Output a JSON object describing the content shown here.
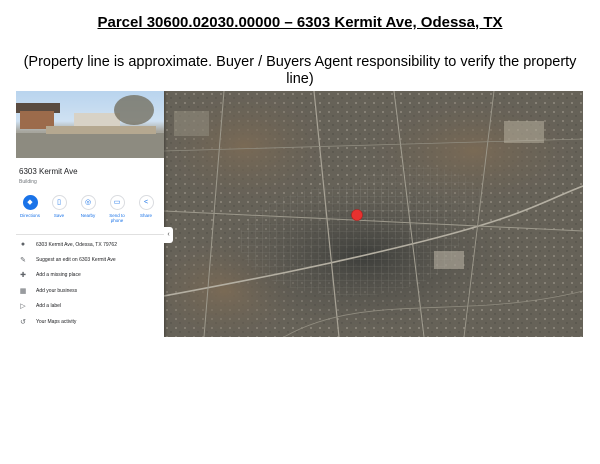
{
  "header": {
    "title": "Parcel 30600.02030.00000 – 6303 Kermit Ave, Odessa, TX",
    "note": "(Property line is approximate.  Buyer / Buyers Agent responsibility to verify the property line)"
  },
  "place": {
    "name": "6303 Kermit Ave",
    "type": "Building"
  },
  "actions": [
    {
      "label": "Directions",
      "icon": "directions-icon"
    },
    {
      "label": "Save",
      "icon": "bookmark-icon"
    },
    {
      "label": "Nearby",
      "icon": "nearby-icon"
    },
    {
      "label": "Send to phone",
      "icon": "phone-icon"
    },
    {
      "label": "Share",
      "icon": "share-icon"
    }
  ],
  "info_rows": [
    {
      "text": "6303 Kermit Ave, Odessa, TX 79762",
      "icon": "location-pin-icon"
    },
    {
      "text": "Suggest an edit on 6303 Kermit Ave",
      "icon": "pencil-icon"
    },
    {
      "text": "Add a missing place",
      "icon": "add-place-icon"
    },
    {
      "text": "Add your business",
      "icon": "storefront-icon"
    },
    {
      "text": "Add a label",
      "icon": "label-icon"
    },
    {
      "text": "Your Maps activity",
      "icon": "history-icon"
    }
  ],
  "colors": {
    "accent": "#1a73e8",
    "marker": "#e8312f"
  }
}
